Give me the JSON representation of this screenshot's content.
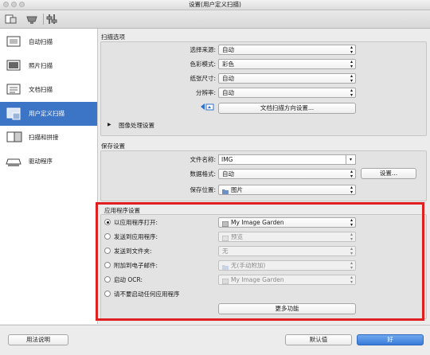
{
  "window": {
    "title": "设置(用户定义扫描)"
  },
  "toolbar": {
    "icons": [
      "scan-from-computer-icon",
      "scan-from-operation-panel-icon",
      "general-settings-icon"
    ]
  },
  "sidebar": {
    "items": [
      {
        "label": "自动扫描",
        "icon": "auto-scan-icon"
      },
      {
        "label": "照片扫描",
        "icon": "photo-scan-icon"
      },
      {
        "label": "文档扫描",
        "icon": "document-scan-icon"
      },
      {
        "label": "用户定义扫描",
        "icon": "custom-scan-icon",
        "active": true
      },
      {
        "label": "扫描和拼接",
        "icon": "scan-and-stitch-icon"
      },
      {
        "label": "驱动程序",
        "icon": "driver-icon"
      }
    ]
  },
  "scan_options": {
    "title": "扫描选项",
    "source_label": "选择来源:",
    "source_value": "自动",
    "color_mode_label": "色彩模式:",
    "color_mode_value": "彩色",
    "paper_size_label": "纸张尺寸:",
    "paper_size_value": "自动",
    "resolution_label": "分辨率:",
    "resolution_value": "自动",
    "orientation_button": "文档扫描方向设置...",
    "image_processing_label": "图像处理设置"
  },
  "save_settings": {
    "title": "保存设置",
    "file_name_label": "文件名称:",
    "file_name_value": "IMG",
    "data_format_label": "数据格式:",
    "data_format_value": "自动",
    "settings_button": "设置...",
    "save_location_label": "保存位置:",
    "save_location_value": "图片"
  },
  "app_settings": {
    "title": "应用程序设置",
    "options": [
      {
        "label": "以应用程序打开:",
        "selected": true,
        "value": "My Image Garden",
        "enabled": true
      },
      {
        "label": "发送到应用程序:",
        "selected": false,
        "value": "预览",
        "enabled": false
      },
      {
        "label": "发送到文件夹:",
        "selected": false,
        "value": "无",
        "enabled": false
      },
      {
        "label": "附加到电子邮件:",
        "selected": false,
        "value": "无(手动附加)",
        "enabled": false
      },
      {
        "label": "启动 OCR:",
        "selected": false,
        "value": "My Image Garden",
        "enabled": false
      },
      {
        "label": "请不要启动任何应用程序",
        "selected": false
      }
    ],
    "more_functions_button": "更多功能"
  },
  "bottom": {
    "help_button": "用法说明",
    "defaults_button": "默认值",
    "ok_button": "好"
  },
  "colors": {
    "accent": "#3c74c6",
    "highlight": "#e02020"
  }
}
